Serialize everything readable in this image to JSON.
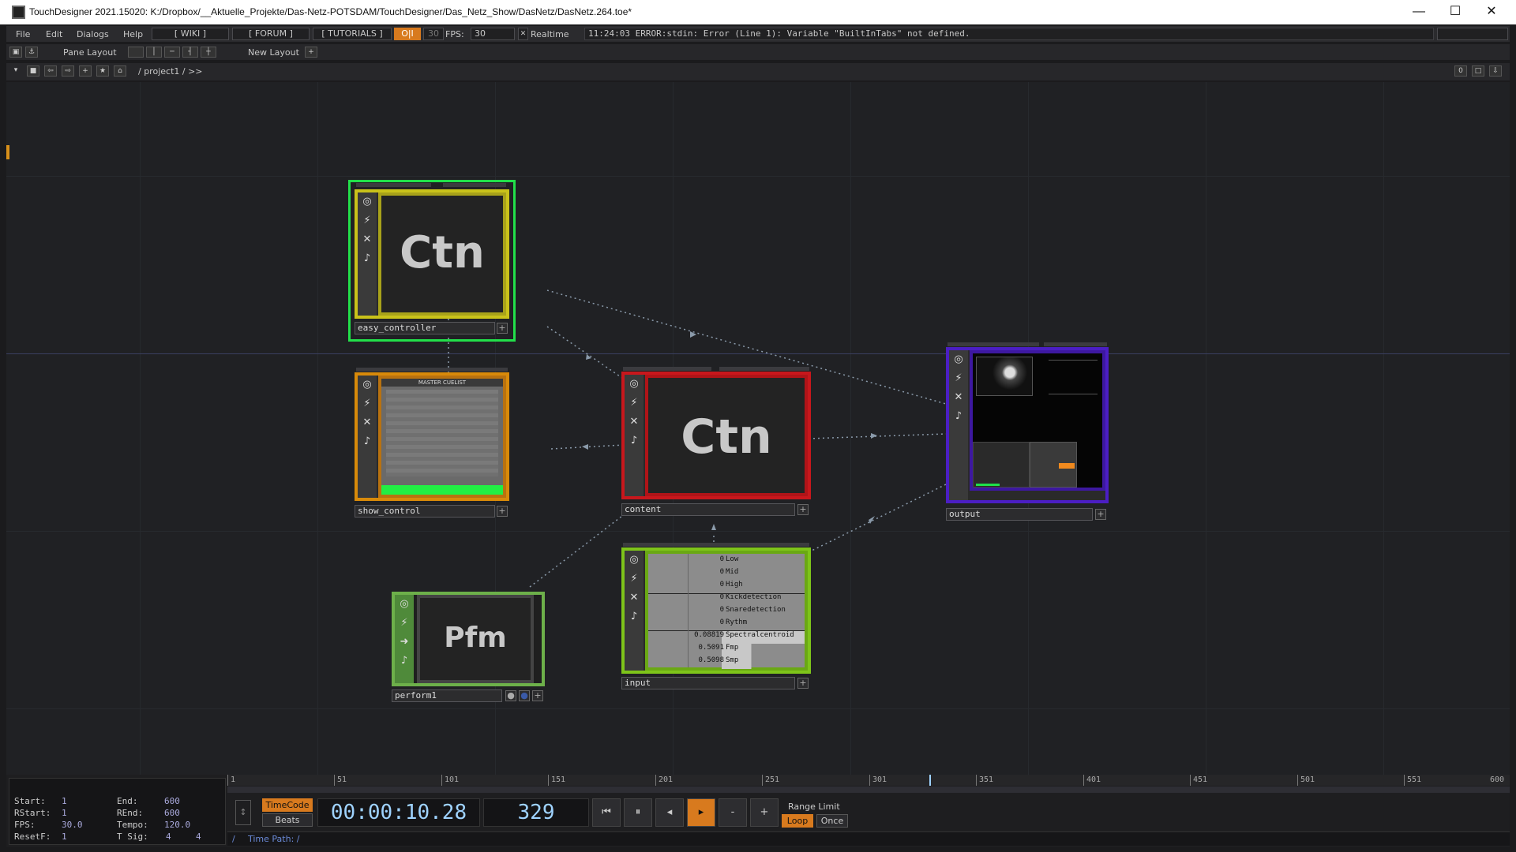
{
  "window": {
    "title": "TouchDesigner 2021.15020: K:/Dropbox/__Aktuelle_Projekte/Das-Netz-POTSDAM/TouchDesigner/Das_Netz_Show/DasNetz/DasNetz.264.toe*",
    "minimize": "—",
    "maximize": "☐",
    "close": "✕"
  },
  "menu": {
    "file": "File",
    "edit": "Edit",
    "dialogs": "Dialogs",
    "help": "Help",
    "wiki": "[ WIKI ]",
    "forum": "[ FORUM ]",
    "tutorials": "[ TUTORIALS ]",
    "oi": "O|I",
    "fps_cap": "30",
    "fps_label": "FPS:",
    "fps_value": "30",
    "realtime_check": "✕",
    "realtime": "Realtime",
    "error": "11:24:03 ERROR:stdin: Error (Line 1): Variable \"BuiltInTabs\" not defined."
  },
  "toolbar": {
    "pane_layout": "Pane Layout",
    "new_layout": "New Layout",
    "add": "+"
  },
  "pathbar": {
    "path": "/ project1 / >>",
    "zero": "0"
  },
  "nodes": {
    "easy_controller": {
      "label": "easy_controller",
      "icon_text": "Ctn",
      "color": "#c9c21a",
      "selected": true
    },
    "show_control": {
      "label": "show_control",
      "color": "#d88a0a",
      "cuelist_title": "MASTER CUELIST"
    },
    "content": {
      "label": "content",
      "icon_text": "Ctn",
      "color": "#c8171c"
    },
    "output": {
      "label": "output",
      "color": "#4b1ec4"
    },
    "perform1": {
      "label": "perform1",
      "icon_text": "Pfm",
      "color": "#6db04a"
    },
    "input": {
      "label": "input",
      "color": "#7ec41a",
      "channels": [
        {
          "value": "0",
          "name": "Low"
        },
        {
          "value": "0",
          "name": "Mid"
        },
        {
          "value": "0",
          "name": "High"
        },
        {
          "value": "0",
          "name": "Kickdetection"
        },
        {
          "value": "0",
          "name": "Snaredetection"
        },
        {
          "value": "0",
          "name": "Rythm"
        },
        {
          "value": "0.08819",
          "name": "Spectralcentroid"
        },
        {
          "value": "0.5091",
          "name": "Fmp"
        },
        {
          "value": "0.5098",
          "name": "Smp"
        }
      ]
    }
  },
  "timeline": {
    "start_label": "Start:",
    "start": "1",
    "end_label": "End:",
    "end": "600",
    "rstart_label": "RStart:",
    "rstart": "1",
    "rend_label": "REnd:",
    "rend": "600",
    "fps_label": "FPS:",
    "fps": "30.0",
    "tempo_label": "Tempo:",
    "tempo": "120.0",
    "resetf_label": "ResetF:",
    "resetf": "1",
    "tsig_label": "T Sig:",
    "tsig_a": "4",
    "tsig_b": "4",
    "ruler": [
      "1",
      "51",
      "101",
      "151",
      "201",
      "251",
      "301",
      "351",
      "401",
      "451",
      "501",
      "551",
      "600"
    ],
    "timecode_btn": "TimeCode",
    "beats_btn": "Beats",
    "timecode": "00:00:10.28",
    "frame": "329",
    "range_limit": "Range Limit",
    "loop": "Loop",
    "once": "Once",
    "time_path_label": "Time Path: /",
    "slash": "/",
    "playhead_frame": 329
  }
}
